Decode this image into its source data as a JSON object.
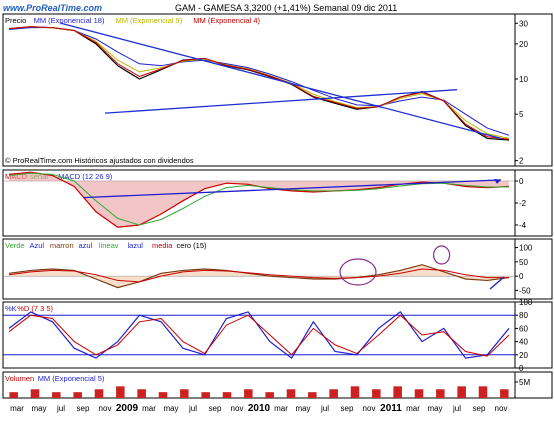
{
  "header": {
    "site": "www.ProRealTime.com",
    "title": "GAM - GAMESA    3,3200 (+1,41%)    Semanal  09 dic 2011"
  },
  "chart_data": [
    {
      "type": "line",
      "panel": "price",
      "legend": [
        {
          "text": "Precio",
          "color": "#000000"
        },
        {
          "text": "MM (Exponencial 18)",
          "color": "#1f1fd0"
        },
        {
          "text": "MM (Exponencial 9)",
          "color": "#b8b800"
        },
        {
          "text": "MM (Exponencial 4)",
          "color": "#cc0000"
        }
      ],
      "scale": "log",
      "ylim": [
        1.8,
        36
      ],
      "yticks": [
        30,
        20,
        10,
        5,
        2
      ],
      "footnote": "© ProRealTime.com  Históricos ajustados con dividendos",
      "x": [
        "mar",
        "may",
        "jul",
        "sep",
        "nov",
        "2009",
        "mar",
        "may",
        "jul",
        "sep",
        "nov",
        "2010",
        "mar",
        "may",
        "jul",
        "sep",
        "nov",
        "2011",
        "mar",
        "may",
        "jul",
        "sep",
        "nov"
      ],
      "series": [
        {
          "name": "Precio",
          "values": [
            27,
            28,
            27.5,
            26,
            20,
            13,
            10,
            12,
            14.5,
            15,
            13,
            12,
            10.5,
            9,
            7,
            6.2,
            5.5,
            5.8,
            7,
            7.8,
            6.5,
            4,
            3.1,
            3.0
          ]
        },
        {
          "name": "MM (Exponencial 18)",
          "values": [
            26.5,
            27.5,
            27.5,
            26,
            22,
            17,
            13.5,
            13,
            14,
            14.5,
            13.5,
            12.5,
            11,
            9.5,
            8,
            6.8,
            6,
            5.9,
            6.5,
            7,
            6.6,
            5,
            3.8,
            3.3
          ]
        },
        {
          "name": "MM (Exponencial 9)",
          "values": [
            27,
            28,
            27.4,
            26,
            21,
            14.5,
            11.5,
            12.5,
            14.2,
            14.8,
            13.2,
            12.2,
            10.7,
            9.2,
            7.4,
            6.4,
            5.7,
            5.8,
            6.8,
            7.5,
            6.5,
            4.4,
            3.4,
            3.1
          ]
        },
        {
          "name": "MM (Exponencial 4)",
          "values": [
            27,
            28,
            27.5,
            26,
            20.5,
            13.5,
            10.5,
            12.2,
            14.4,
            15,
            13.1,
            12.1,
            10.6,
            9.1,
            7.1,
            6.3,
            5.6,
            5.8,
            7,
            7.7,
            6.5,
            4.1,
            3.2,
            3.05
          ]
        }
      ],
      "trendlines": [
        {
          "from": [
            "jul",
            30
          ],
          "to": [
            "nov",
            3.1
          ],
          "color": "#2030d0"
        },
        {
          "from": [
            "nov",
            5.1
          ],
          "to": [
            "jul",
            8.1
          ],
          "color": "#2030d0"
        }
      ]
    },
    {
      "type": "area",
      "panel": "macd",
      "legend": [
        {
          "text": "MACD",
          "color": "#cc0000"
        },
        {
          "text": "- señal",
          "color": "#33aa33"
        },
        {
          "text": "MACD (12 26 9)",
          "color": "#1f1fd0"
        }
      ],
      "ylim": [
        -5,
        1
      ],
      "yticks": [
        0,
        -2,
        -4
      ],
      "series": [
        {
          "name": "MACD",
          "values": [
            0.6,
            0.8,
            0.5,
            -0.5,
            -2.8,
            -4.2,
            -4,
            -3,
            -1.8,
            -0.7,
            -0.2,
            -0.3,
            -0.7,
            -0.9,
            -1,
            -0.9,
            -0.8,
            -0.6,
            -0.3,
            -0.1,
            -0.2,
            -0.5,
            -0.6,
            -0.5
          ]
        },
        {
          "name": "señal",
          "values": [
            0.5,
            0.7,
            0.6,
            0,
            -1.8,
            -3.4,
            -4,
            -3.5,
            -2.5,
            -1.4,
            -0.6,
            -0.4,
            -0.6,
            -0.8,
            -0.9,
            -0.9,
            -0.85,
            -0.7,
            -0.45,
            -0.25,
            -0.2,
            -0.4,
            -0.55,
            -0.55
          ]
        }
      ],
      "arrow": {
        "from": [
          "sep",
          -0.6
        ],
        "to": [
          "nov",
          0.1
        ],
        "color": "#1f1fd0"
      }
    },
    {
      "type": "line",
      "panel": "oscillator",
      "legend": [
        {
          "text": "Verde",
          "color": "#33aa33"
        },
        {
          "text": "Azul",
          "color": "#1f1fd0"
        },
        {
          "text": "marron",
          "color": "#7a3b10"
        },
        {
          "text": "azul",
          "color": "#1f1fd0"
        },
        {
          "text": "lineav",
          "color": "#33aa33"
        },
        {
          "text": "lazul",
          "color": "#1f1fd0"
        },
        {
          "text": "media",
          "color": "#cc0000"
        },
        {
          "text": "cero (15)",
          "color": "#000000"
        }
      ],
      "ylim": [
        -80,
        130
      ],
      "yticks": [
        100,
        50,
        0,
        -50
      ],
      "series": [
        {
          "name": "marron",
          "values": [
            10,
            20,
            25,
            20,
            -10,
            -40,
            -20,
            10,
            20,
            25,
            20,
            10,
            0,
            -5,
            -10,
            -10,
            -5,
            5,
            20,
            40,
            15,
            -10,
            -15,
            -5
          ]
        },
        {
          "name": "media",
          "values": [
            5,
            15,
            20,
            18,
            5,
            -15,
            -20,
            0,
            15,
            20,
            18,
            12,
            5,
            0,
            -5,
            -8,
            -5,
            0,
            10,
            25,
            20,
            5,
            -5,
            -5
          ]
        }
      ],
      "annotations": [
        "circle-nov-2010",
        "circle-may-2011",
        "arrow-nov-2011"
      ]
    },
    {
      "type": "line",
      "panel": "stochastic",
      "legend": [
        {
          "text": "%K",
          "color": "#1f1fd0"
        },
        {
          "text": "%D (7 3 5)",
          "color": "#cc0000"
        }
      ],
      "ylim": [
        0,
        100
      ],
      "yticks": [
        100,
        80,
        60,
        40,
        20,
        0
      ],
      "series": [
        {
          "name": "%K",
          "values": [
            60,
            85,
            70,
            30,
            15,
            40,
            80,
            70,
            30,
            20,
            75,
            85,
            40,
            15,
            70,
            25,
            20,
            60,
            85,
            40,
            60,
            15,
            20,
            60
          ]
        },
        {
          "name": "%D",
          "values": [
            55,
            80,
            75,
            40,
            20,
            35,
            70,
            75,
            40,
            22,
            65,
            80,
            50,
            20,
            60,
            35,
            22,
            50,
            80,
            50,
            55,
            25,
            18,
            50
          ]
        }
      ],
      "reference_lines": [
        80,
        20
      ]
    },
    {
      "type": "bar",
      "panel": "volume",
      "legend": [
        {
          "text": "Volumen",
          "color": "#cc0000"
        },
        {
          "text": "MM (Exponencial 5)",
          "color": "#1f1fd0"
        }
      ],
      "yticks": [
        "5M"
      ],
      "values": [
        2,
        3,
        2,
        2,
        3,
        4,
        3,
        2,
        3,
        2,
        2,
        3,
        2,
        3,
        2,
        3,
        4,
        3,
        4,
        3,
        3,
        4,
        4,
        3
      ]
    }
  ],
  "x_axis_labels": [
    "mar",
    "may",
    "jul",
    "sep",
    "nov",
    "2009",
    "mar",
    "may",
    "jul",
    "sep",
    "nov",
    "2010",
    "mar",
    "may",
    "jul",
    "sep",
    "nov",
    "2011",
    "mar",
    "may",
    "jul",
    "sep",
    "nov"
  ]
}
